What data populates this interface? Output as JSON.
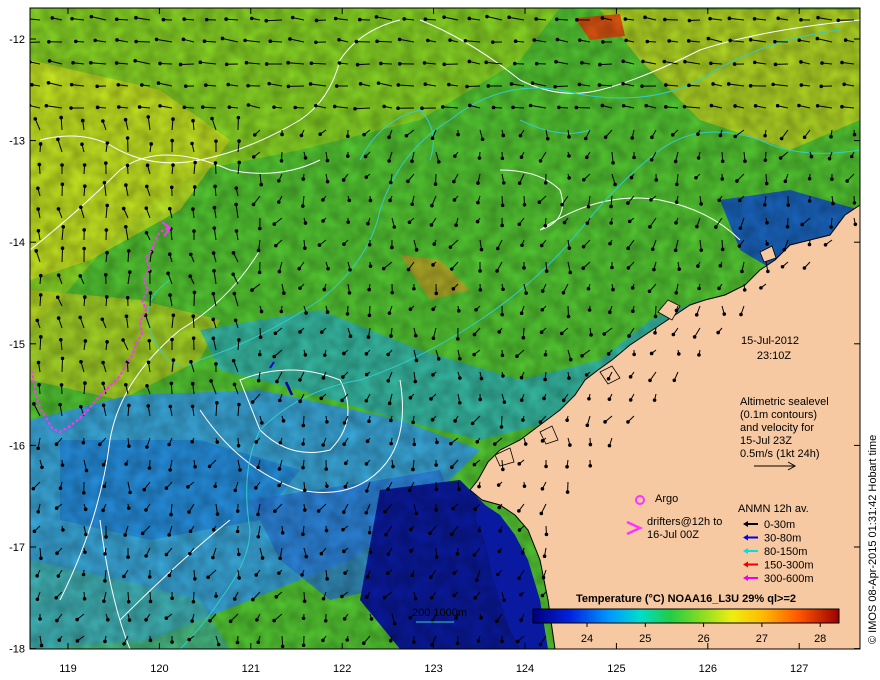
{
  "map": {
    "date": "15-Jul-2012",
    "time": "23:10Z",
    "sealevel_text": [
      "Altimetric sealevel",
      "(0.1m contours)",
      "and velocity for",
      "15-Jul 23Z",
      "0.5m/s (1kt 24h)"
    ],
    "argo_label": "Argo",
    "drifters_text": [
      "drifters@12h to",
      "16-Jul 00Z"
    ],
    "anmn_title": "ANMN 12h av.",
    "anmn_legend": [
      {
        "label": "0-30m",
        "color": "#000000"
      },
      {
        "label": "30-80m",
        "color": "#0000ee"
      },
      {
        "label": "80-150m",
        "color": "#00e0e0"
      },
      {
        "label": "150-300m",
        "color": "#ee0000"
      },
      {
        "label": "300-600m",
        "color": "#ee00ee"
      }
    ],
    "bathy_label": "200  1000m",
    "colorbar_title": "Temperature (°C) NOAA16_L3U 29% ql>=2",
    "colorbar_ticks": [
      "24",
      "25",
      "26",
      "27",
      "28"
    ],
    "credit": "© IMOS 08-Apr-2015 01:31:42 Hobart time",
    "x_ticks": [
      "119",
      "120",
      "121",
      "122",
      "123",
      "124",
      "125",
      "126",
      "127"
    ],
    "y_ticks": [
      "-12",
      "-13",
      "-14",
      "-15",
      "-16",
      "-17",
      "-18"
    ],
    "colors": {
      "land": "#f6c9a3",
      "coast": "#000000",
      "contour": "#ffffff",
      "bathy": "#33cccc",
      "drifter": "#ff33ff"
    }
  }
}
